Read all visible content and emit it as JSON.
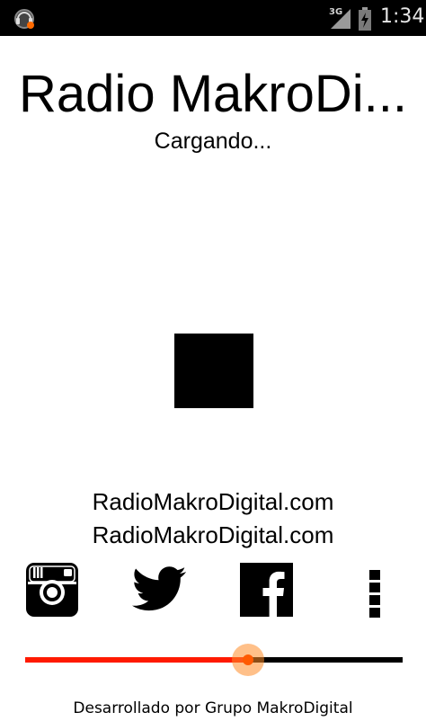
{
  "status_bar": {
    "network": "3G",
    "time": "1:34",
    "icons": [
      "app-notification-icon",
      "signal-icon",
      "battery-icon"
    ]
  },
  "player": {
    "station_title": "Radio MakroDi...",
    "status": "Cargando...",
    "control": "stop-icon"
  },
  "site": {
    "line1": "RadioMakroDigital.com",
    "line2": "RadioMakroDigital.com"
  },
  "social": {
    "items": [
      "instagram-icon",
      "twitter-icon",
      "facebook-icon",
      "overflow-menu-icon"
    ]
  },
  "volume": {
    "level": 0.59,
    "fill_color": "#ff1a00",
    "thumb_color": "#ff5a00"
  },
  "footer": {
    "credit": "Desarrollado por Grupo MakroDigital"
  }
}
